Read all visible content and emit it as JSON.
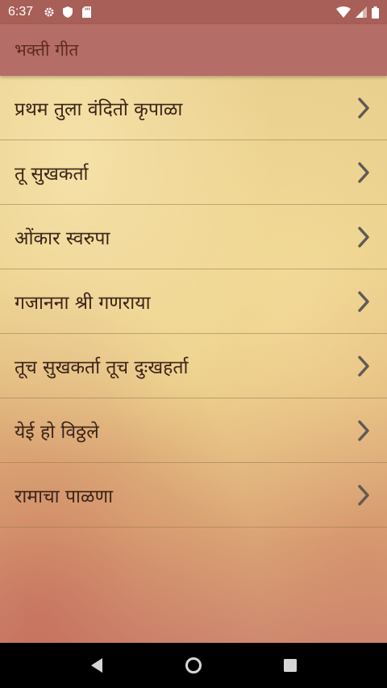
{
  "status_bar": {
    "time": "6:37",
    "left_icons": [
      "gear-icon",
      "shield-icon",
      "sd-card-icon"
    ],
    "right_icons": [
      "wifi-icon",
      "cellular-signal-icon",
      "battery-icon"
    ]
  },
  "app_bar": {
    "title": "भक्ती गीत"
  },
  "songs": [
    {
      "label": "प्रथम तुला वंदितो कृपाळा"
    },
    {
      "label": "तू सुखकर्ता"
    },
    {
      "label": "ओंकार स्वरुपा"
    },
    {
      "label": "गजानना श्री गणराया"
    },
    {
      "label": "तूच सुखकर्ता तूच दुःखहर्ता"
    },
    {
      "label": "येई हो विठ्ठले"
    },
    {
      "label": "रामाचा पाळणा"
    }
  ],
  "item_icon": "chevron-right-icon",
  "nav_bar": {
    "buttons": [
      "back-icon",
      "home-icon",
      "recents-icon"
    ]
  },
  "colors": {
    "status_bar": "#a85f57",
    "app_bar": "#b56d67",
    "title_text": "#5e2a20",
    "item_text": "#3a2418",
    "chevron": "#5f5a55"
  }
}
